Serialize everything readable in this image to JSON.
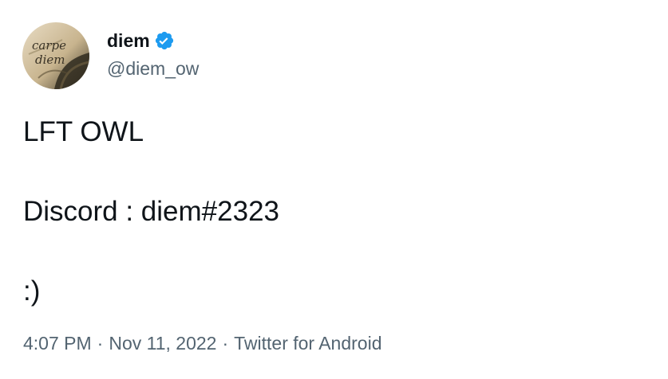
{
  "author": {
    "display_name": "diem",
    "handle": "@diem_ow",
    "verified": true,
    "avatar_text": "carpe diem",
    "verified_color": "#1d9bf0"
  },
  "tweet": {
    "lines": [
      "LFT OWL",
      "Discord : diem#2323",
      ":)"
    ]
  },
  "meta": {
    "time": "4:07 PM",
    "date": "Nov 11, 2022",
    "source": "Twitter for Android",
    "separator": "·"
  },
  "icons": {
    "verified": "verified-badge-icon"
  }
}
